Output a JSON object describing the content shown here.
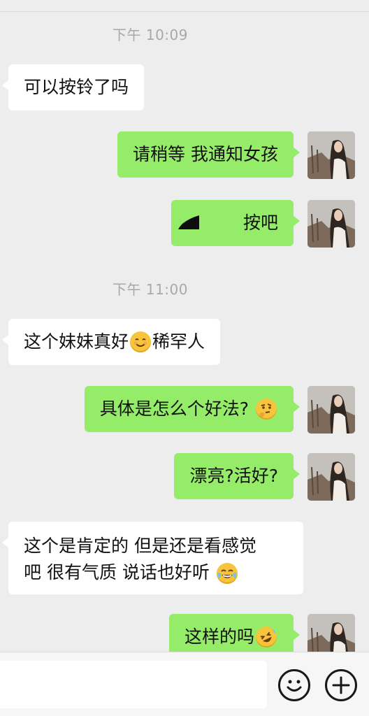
{
  "messages": [
    {
      "type": "time",
      "text": "下午 10:09"
    },
    {
      "type": "in",
      "text": "可以按铃了吗"
    },
    {
      "type": "out",
      "text": "请稍等 我通知女孩"
    },
    {
      "type": "out",
      "text": "按吧"
    },
    {
      "type": "time",
      "text": "下午 11:00"
    },
    {
      "type": "in",
      "text_before": "这个妹妹真好",
      "emoji": "smiling-face-emoji",
      "text_after": "稀罕人"
    },
    {
      "type": "out",
      "text": "具体是怎么个好法?",
      "emoji": "thinking-face-emoji"
    },
    {
      "type": "out",
      "text": "漂亮?活好?"
    },
    {
      "type": "in",
      "line1": "这个是肯定的 但是还是看感觉",
      "line2": "吧 很有气质 说话也好听",
      "emoji": "tears-of-joy-emoji"
    },
    {
      "type": "out",
      "text": "这样的吗",
      "emoji": "rolling-laughing-emoji"
    }
  ],
  "input": {
    "value": "",
    "emoji_button_icon": "smiley-icon",
    "more_button_icon": "plus-circle-icon"
  },
  "colors": {
    "background": "#ededed",
    "incoming_bubble": "#ffffff",
    "outgoing_bubble": "#95ec69",
    "timestamp": "#a8a8a8"
  }
}
